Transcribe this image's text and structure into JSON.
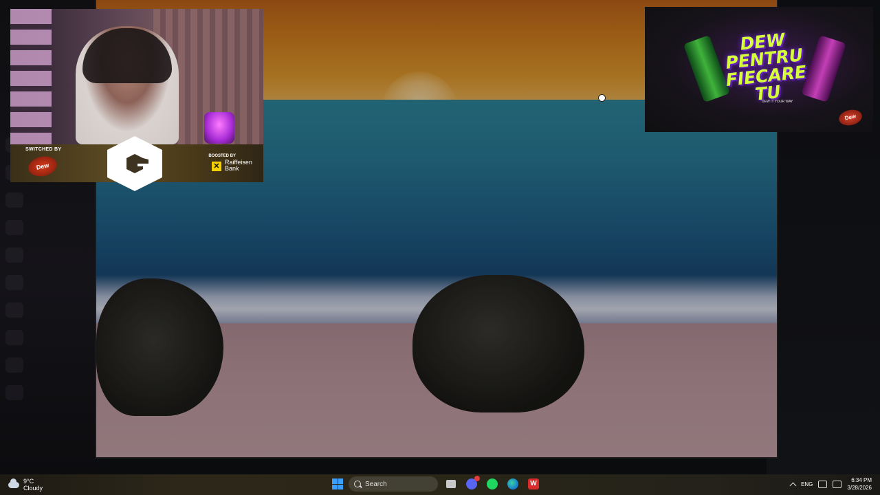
{
  "stream_overlay": {
    "switched_by_label": "SWITCHED BY",
    "switched_by_brand": "Dew",
    "boosted_by_label": "BOOSTED BY",
    "bank_name_line1": "Raiffeisen",
    "bank_name_line2": "Bank"
  },
  "ad": {
    "headline": "DEW PENTRU FIECARE TU",
    "tagline": "DEW IT YOUR WAY",
    "brand": "Dew"
  },
  "taskbar": {
    "weather_temp": "9°C",
    "weather_desc": "Cloudy",
    "search_placeholder": "Search",
    "language": "ENG",
    "time": "6:34 PM",
    "date": "3/28/2026",
    "apps": [
      "start-icon",
      "search",
      "file-explorer-icon",
      "discord-icon",
      "spotify-icon",
      "edge-icon",
      "wps-icon"
    ]
  },
  "colors": {
    "sky_top": "#c2651a",
    "sea": "#1f5f88",
    "sand": "#c39ea6",
    "ad_accent": "#d6ff3a",
    "taskbar": "#2a2618"
  }
}
